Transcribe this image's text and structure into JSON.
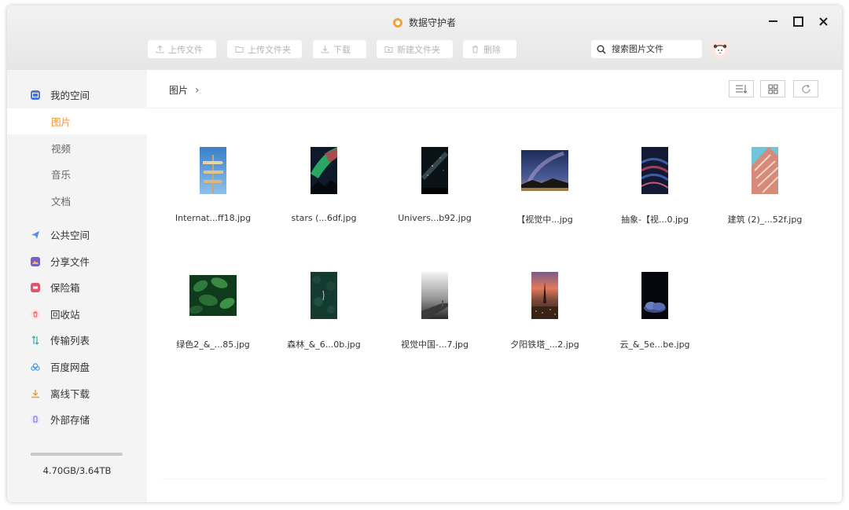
{
  "window": {
    "title": "数据守护者"
  },
  "toolbar": {
    "upload_file": "上传文件",
    "upload_folder": "上传文件夹",
    "download": "下载",
    "new_folder": "新建文件夹",
    "delete": "删除"
  },
  "search": {
    "placeholder": "搜索图片文件"
  },
  "sidebar": {
    "my_space": "我的空间",
    "sub_items": [
      "图片",
      "视频",
      "音乐",
      "文档"
    ],
    "public_space": "公共空间",
    "share_files": "分享文件",
    "safe_box": "保险箱",
    "recycle_bin": "回收站",
    "transfer_list": "传输列表",
    "baidu_pan": "百度网盘",
    "offline_download": "离线下载",
    "external_storage": "外部存储",
    "storage_text": "4.70GB/3.64TB",
    "storage_used_fraction": 0.0013
  },
  "breadcrumb": {
    "current": "图片"
  },
  "files": [
    {
      "name": "Internat...ff18.jpg",
      "icon": "signpost-image-icon"
    },
    {
      "name": "stars (...6df.jpg",
      "icon": "aurora-image-icon"
    },
    {
      "name": "Univers...b92.jpg",
      "icon": "galaxy-image-icon"
    },
    {
      "name": "【视觉中...jpg",
      "icon": "night-sky-image-icon"
    },
    {
      "name": "抽象-【视...0.jpg",
      "icon": "abstract-image-icon"
    },
    {
      "name": "建筑 (2)_...52f.jpg",
      "icon": "building-image-icon"
    },
    {
      "name": "绿色2_&_...85.jpg",
      "icon": "leaves-image-icon"
    },
    {
      "name": "森林_&_6...0b.jpg",
      "icon": "forest-image-icon"
    },
    {
      "name": "视觉中国-...7.jpg",
      "icon": "pier-image-icon"
    },
    {
      "name": "夕阳铁塔_...2.jpg",
      "icon": "sunset-tower-image-icon"
    },
    {
      "name": "云_&_5e...be.jpg",
      "icon": "cloud-image-icon"
    }
  ],
  "colors": {
    "accent": "#f0953c",
    "sidebar_bg": "#f4f4f4",
    "titlebar_bg": "#e9e9e9"
  }
}
